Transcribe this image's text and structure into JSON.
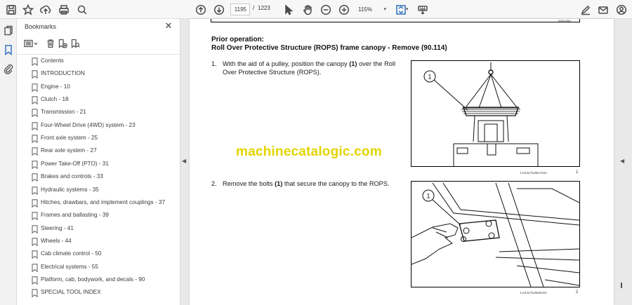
{
  "toolbar": {
    "current_page": "1195",
    "page_separator": "/",
    "total_pages": "1223",
    "zoom": "115%"
  },
  "bookmarks_panel": {
    "title": "Bookmarks",
    "close_glyph": "✕",
    "items": [
      {
        "label": "Contents"
      },
      {
        "label": "INTRODUCTION"
      },
      {
        "label": "Engine - 10"
      },
      {
        "label": "Clutch - 18"
      },
      {
        "label": "Transmission - 21"
      },
      {
        "label": "Four-Wheel Drive (4WD) system - 23"
      },
      {
        "label": "Front axle system - 25"
      },
      {
        "label": "Rear axle system - 27"
      },
      {
        "label": "Power Take-Off (PTO) - 31"
      },
      {
        "label": "Brakes and controls - 33"
      },
      {
        "label": "Hydraulic systems - 35"
      },
      {
        "label": "Hitches, drawbars, and implement couplings - 37"
      },
      {
        "label": "Frames and ballasting - 39"
      },
      {
        "label": "Steering - 41"
      },
      {
        "label": "Wheels - 44"
      },
      {
        "label": "Cab climate control - 50"
      },
      {
        "label": "Electrical systems - 55"
      },
      {
        "label": "Platform, cab, bodywork, and decals - 90"
      },
      {
        "label": "SPECIAL TOOL INDEX"
      }
    ]
  },
  "document": {
    "prev_page_code": "BSB19BA",
    "heading_line1": "Prior operation:",
    "heading_line2": "Roll Over Protective Structure (ROPS) frame canopy - Remove (90.114)",
    "steps": [
      {
        "num": "1.",
        "text_a": "With the aid of a pulley, position the canopy ",
        "bold": "(1)",
        "text_b": " over the Roll Over Protective Structure (ROPS)."
      },
      {
        "num": "2.",
        "text_a": "Remove the bolts ",
        "bold": "(1)",
        "text_b": " that secure the canopy to the ROPS."
      }
    ],
    "figures": [
      {
        "callout": "1",
        "caption": "LAIL11TL0617A0A",
        "number": "1"
      },
      {
        "callout": "1",
        "caption": "LAIL11TL0618A0A",
        "number": "2"
      }
    ],
    "watermark": "machinecatalogic.com"
  },
  "colors": {
    "watermark": "#e3d400",
    "toolbar_bg": "#f7f7f7",
    "doc_bg": "#e9e9e9"
  },
  "icons": [
    "save-icon",
    "star-icon",
    "upload-icon",
    "print-icon",
    "zoom-icon",
    "arrow-up-icon",
    "arrow-down-icon",
    "cursor-icon",
    "hand-icon",
    "zoom-out-icon",
    "zoom-in-icon",
    "fit-page-icon",
    "keyboard-icon",
    "sign-icon",
    "mail-icon",
    "account-icon",
    "pages-icon",
    "bookmark-icon",
    "attachment-icon"
  ]
}
